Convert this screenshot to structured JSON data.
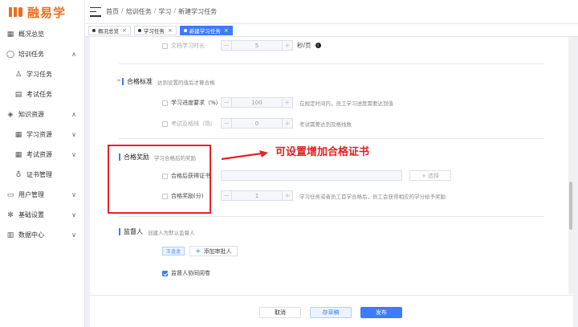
{
  "brand": {
    "logo_text": "融易学",
    "logo_mark": "融"
  },
  "sidebar": {
    "items": [
      {
        "label": "概况总览",
        "icon": "grid-icon",
        "arrow": ""
      },
      {
        "label": "培训任务",
        "icon": "user-icon",
        "arrow": "∧"
      },
      {
        "label": "学习任务",
        "icon": "person-icon",
        "arrow": ""
      },
      {
        "label": "考试任务",
        "icon": "document-icon",
        "arrow": ""
      },
      {
        "label": "知识资源",
        "icon": "graduation-cap-icon",
        "arrow": "∧"
      },
      {
        "label": "学习资源",
        "icon": "grid-icon",
        "arrow": "∨"
      },
      {
        "label": "考试资源",
        "icon": "grid-icon",
        "arrow": "∨"
      },
      {
        "label": "证书管理",
        "icon": "badge-icon",
        "arrow": ""
      },
      {
        "label": "用户管理",
        "icon": "folder-icon",
        "arrow": "∨"
      },
      {
        "label": "基础设置",
        "icon": "settings-icon",
        "arrow": "∨"
      },
      {
        "label": "数据中心",
        "icon": "chart-icon",
        "arrow": "∨"
      }
    ]
  },
  "header": {
    "breadcrumb": [
      "首页",
      "培训任务",
      "学习",
      "新建学习任务"
    ],
    "separator": "/"
  },
  "tabs": [
    {
      "label": "概况总览",
      "active": false
    },
    {
      "label": "学习任务",
      "active": false
    },
    {
      "label": "新建学习任务",
      "active": true
    }
  ],
  "form": {
    "doc_time": {
      "label": "文档学习时长",
      "value": "5",
      "unit": "秒/页"
    },
    "pass_standard": {
      "required_mark": "*",
      "title": "合格标准",
      "subtitle": "达到设置的值后才算合格"
    },
    "progress_req": {
      "label": "学习进度要求（%）",
      "value": "100",
      "hint": "在规定时间内，员工学习进度需要达到值"
    },
    "exam_pass": {
      "label": "考试及格线（场）",
      "value": "0",
      "hint": "考试需要达到及格线数"
    },
    "pass_reward": {
      "title": "合格奖励",
      "subtitle": "学习合格后的奖励"
    },
    "certificate": {
      "label": "合格后获得证书",
      "select_label": "+ 选择"
    },
    "reward_points": {
      "label": "合格奖励(分)",
      "value": "1",
      "hint": "学习任务或者员工首学合格后，员工会获得相应的学分给予奖励"
    },
    "supervisor": {
      "title": "监督人",
      "subtitle": "创建人为默认监督人",
      "tag": "王金龙",
      "add_label": "添加审批人",
      "collab_label": "监督人协同阅卷"
    },
    "stepper_minus": "−",
    "stepper_plus": "+"
  },
  "annotation": {
    "text": "可设置增加合格证书"
  },
  "footer": {
    "cancel": "取消",
    "draft": "存草稿",
    "publish": "发布"
  },
  "colors": {
    "brand": "#f26b1d",
    "accent": "#3e7bfa",
    "annotation": "#e8222a"
  }
}
